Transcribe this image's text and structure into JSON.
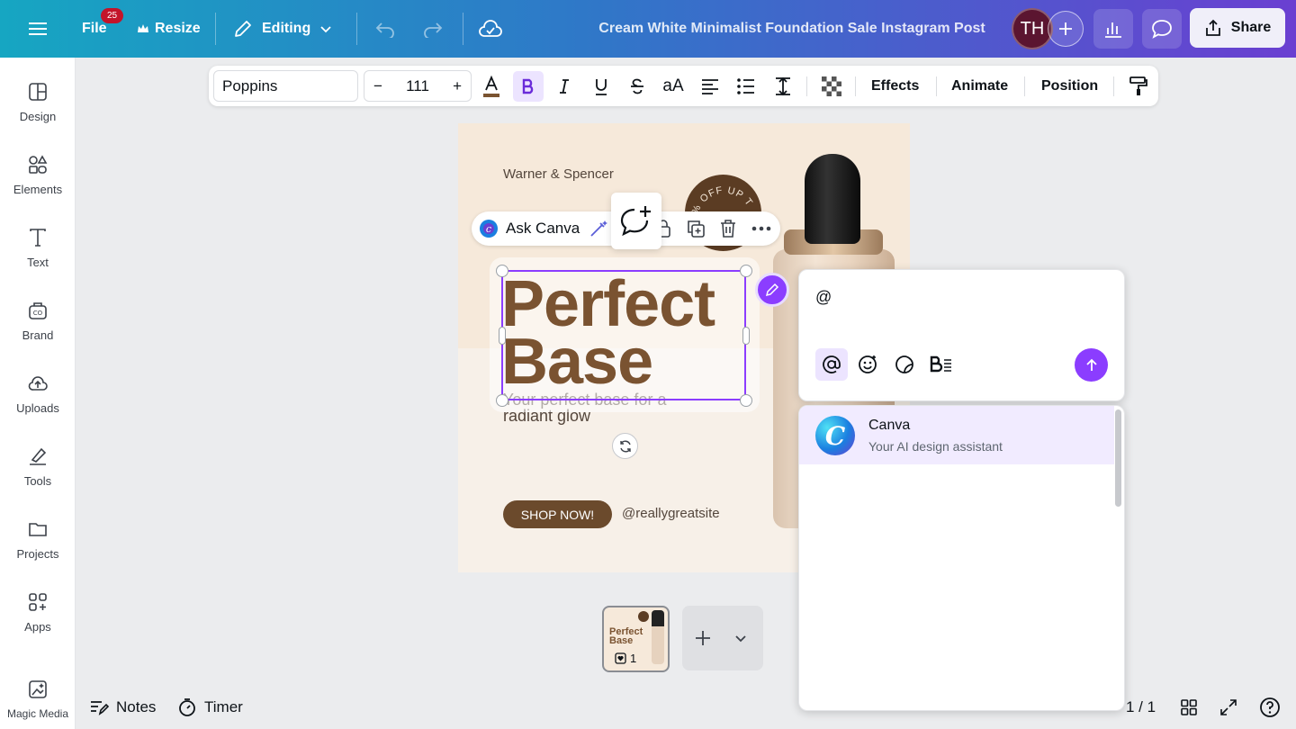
{
  "topbar": {
    "menu_icon": "hamburger-icon",
    "file_label": "File",
    "notification_badge": "25",
    "resize_label": "Resize",
    "editing_label": "Editing",
    "doc_title": "Cream White Minimalist Foundation Sale Instagram Post",
    "avatar_initials": "TH",
    "share_label": "Share"
  },
  "sidebar": {
    "items": [
      {
        "label": "Design",
        "icon": "design-icon"
      },
      {
        "label": "Elements",
        "icon": "elements-icon"
      },
      {
        "label": "Text",
        "icon": "text-icon"
      },
      {
        "label": "Brand",
        "icon": "brand-icon"
      },
      {
        "label": "Uploads",
        "icon": "uploads-icon"
      },
      {
        "label": "Tools",
        "icon": "tools-icon"
      },
      {
        "label": "Projects",
        "icon": "projects-icon"
      },
      {
        "label": "Apps",
        "icon": "apps-icon"
      },
      {
        "label": "Magic Media",
        "icon": "magic-media-icon"
      }
    ]
  },
  "toolbar": {
    "font": "Poppins",
    "font_size": "111",
    "minus": "−",
    "plus": "+",
    "case_label": "aA",
    "effects_label": "Effects",
    "animate_label": "Animate",
    "position_label": "Position"
  },
  "design": {
    "brand_name": "Warner & Spencer",
    "badge_text": "5% OFF  UP TO",
    "headline_line1": "Perfect",
    "headline_line2": "Base",
    "tagline": "Your perfect base for a radiant glow",
    "shop_button": "SHOP NOW!",
    "site": "@reallygreatsite"
  },
  "context_menu": {
    "ask_canva_label": "Ask Canva"
  },
  "comment": {
    "input_value": "@",
    "mention": {
      "name": "Canva",
      "description": "Your AI design assistant"
    }
  },
  "pages": {
    "thumb_title_1": "Perfect",
    "thumb_title_2": "Base",
    "comment_count": "1",
    "page_count": "1 / 1"
  },
  "bottombar": {
    "notes_label": "Notes",
    "timer_label": "Timer"
  },
  "colors": {
    "accent": "#8b3dff",
    "headline": "#7a5331",
    "button": "#6b4a2c"
  }
}
